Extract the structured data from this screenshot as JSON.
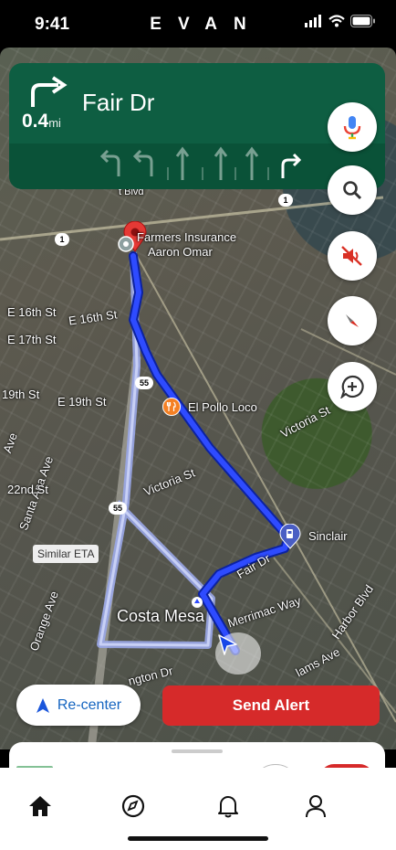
{
  "status_bar": {
    "time": "9:41",
    "brand": "EVAN"
  },
  "navigation": {
    "street": "Fair Dr",
    "distance_value": "0.4",
    "distance_unit": "mi",
    "lanes": [
      "slight-left",
      "slight-left",
      "straight",
      "straight",
      "straight",
      "right-turn"
    ]
  },
  "map": {
    "labels": {
      "farmers": "Farmers Insurance",
      "aaron": "Aaron Omar",
      "e16_a": "E 16th St",
      "e16_b": "E 16th St",
      "e17": "E 17th St",
      "e19_a": "19th St",
      "e19_b": "E 19th St",
      "el_pollo": "El Pollo Loco",
      "victoria_a": "Victoria St",
      "victoria_b": "Victoria St",
      "santa_ana": "Santa Ana Ave",
      "ave_left": "Ave",
      "st22": "22nd St",
      "sinclair": "Sinclair",
      "fair_dr": "Fair Dr",
      "similar_eta": "Similar ETA",
      "orange_ave": "Orange Ave",
      "costa_mesa": "Costa Mesa",
      "merrimac": "Merrimac Way",
      "harbor": "Harbor Blvd",
      "arlington": "ngton Dr",
      "adams": "lams Ave",
      "bvd": "t Blvd"
    },
    "shields": {
      "r1a": "1",
      "r1b": "1",
      "r55a": "55",
      "r55b": "55"
    }
  },
  "controls": {
    "recenter_label": "Re-center",
    "send_alert_label": "Send Alert"
  },
  "tabs": [
    {
      "name": "home",
      "active": true
    },
    {
      "name": "explore",
      "active": false
    },
    {
      "name": "notifications",
      "active": false
    },
    {
      "name": "profile",
      "active": false
    }
  ],
  "colors": {
    "nav_green": "#0e5e42",
    "route_blue": "#1a3cf0",
    "alert_red": "#d62a2a",
    "recenter_blue": "#1565c0"
  }
}
